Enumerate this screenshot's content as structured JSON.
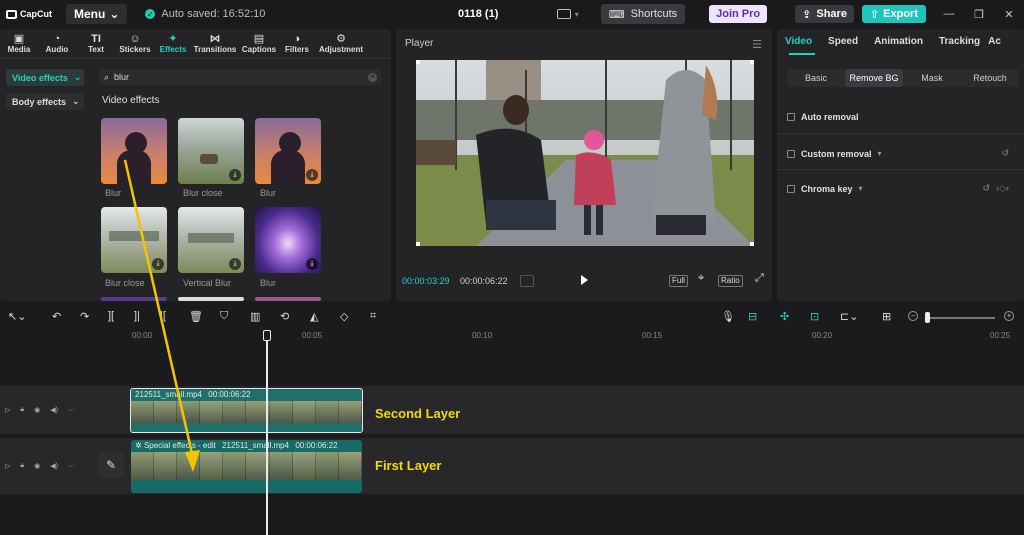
{
  "app": {
    "logo": "CapCut",
    "menu_label": "Menu",
    "autosave": "Auto saved: 16:52:10",
    "project_title": "0118 (1)"
  },
  "topbar": {
    "shortcuts": "Shortcuts",
    "join_pro": "Join Pro",
    "share": "Share",
    "export": "Export"
  },
  "tooltabs": [
    {
      "label": "Media",
      "icon": "▣"
    },
    {
      "label": "Audio",
      "icon": "◔"
    },
    {
      "label": "Text",
      "icon": "TI"
    },
    {
      "label": "Stickers",
      "icon": "☺"
    },
    {
      "label": "Effects",
      "icon": "✦"
    },
    {
      "label": "Transitions",
      "icon": "⋈"
    },
    {
      "label": "Captions",
      "icon": "▤"
    },
    {
      "label": "Filters",
      "icon": "◑"
    },
    {
      "label": "Adjustment",
      "icon": "⚙"
    }
  ],
  "sidebar": {
    "video_effects": "Video effects",
    "body_effects": "Body effects"
  },
  "search": {
    "value": "blur"
  },
  "effects": {
    "section_title": "Video effects",
    "items": [
      {
        "label": "Blur"
      },
      {
        "label": "Blur close"
      },
      {
        "label": "Blur"
      },
      {
        "label": "Blur close"
      },
      {
        "label": "Vertical Blur"
      },
      {
        "label": "Blur"
      }
    ]
  },
  "player": {
    "title": "Player",
    "time_current": "00:00:03:29",
    "time_total": "00:00:06:22",
    "full": "Full",
    "ratio": "Ratio"
  },
  "right_panel": {
    "tabs": [
      "Video",
      "Speed",
      "Animation",
      "Tracking",
      "Ac"
    ],
    "subtabs": [
      "Basic",
      "Remove BG",
      "Mask",
      "Retouch"
    ],
    "auto_removal": "Auto removal",
    "custom_removal": "Custom removal",
    "chroma_key": "Chroma key"
  },
  "timeline": {
    "ruler": [
      "00:00",
      "00:05",
      "00:10",
      "00:15",
      "00:20",
      "00:25"
    ],
    "clip_top": {
      "name": "212511_small.mp4",
      "duration": "00:00:06:22"
    },
    "clip_bottom": {
      "effect": "Special effects - edit",
      "name": "212511_small.mp4",
      "duration": "00:00:06:22"
    },
    "label_second": "Second Layer",
    "label_first": "First Layer"
  }
}
